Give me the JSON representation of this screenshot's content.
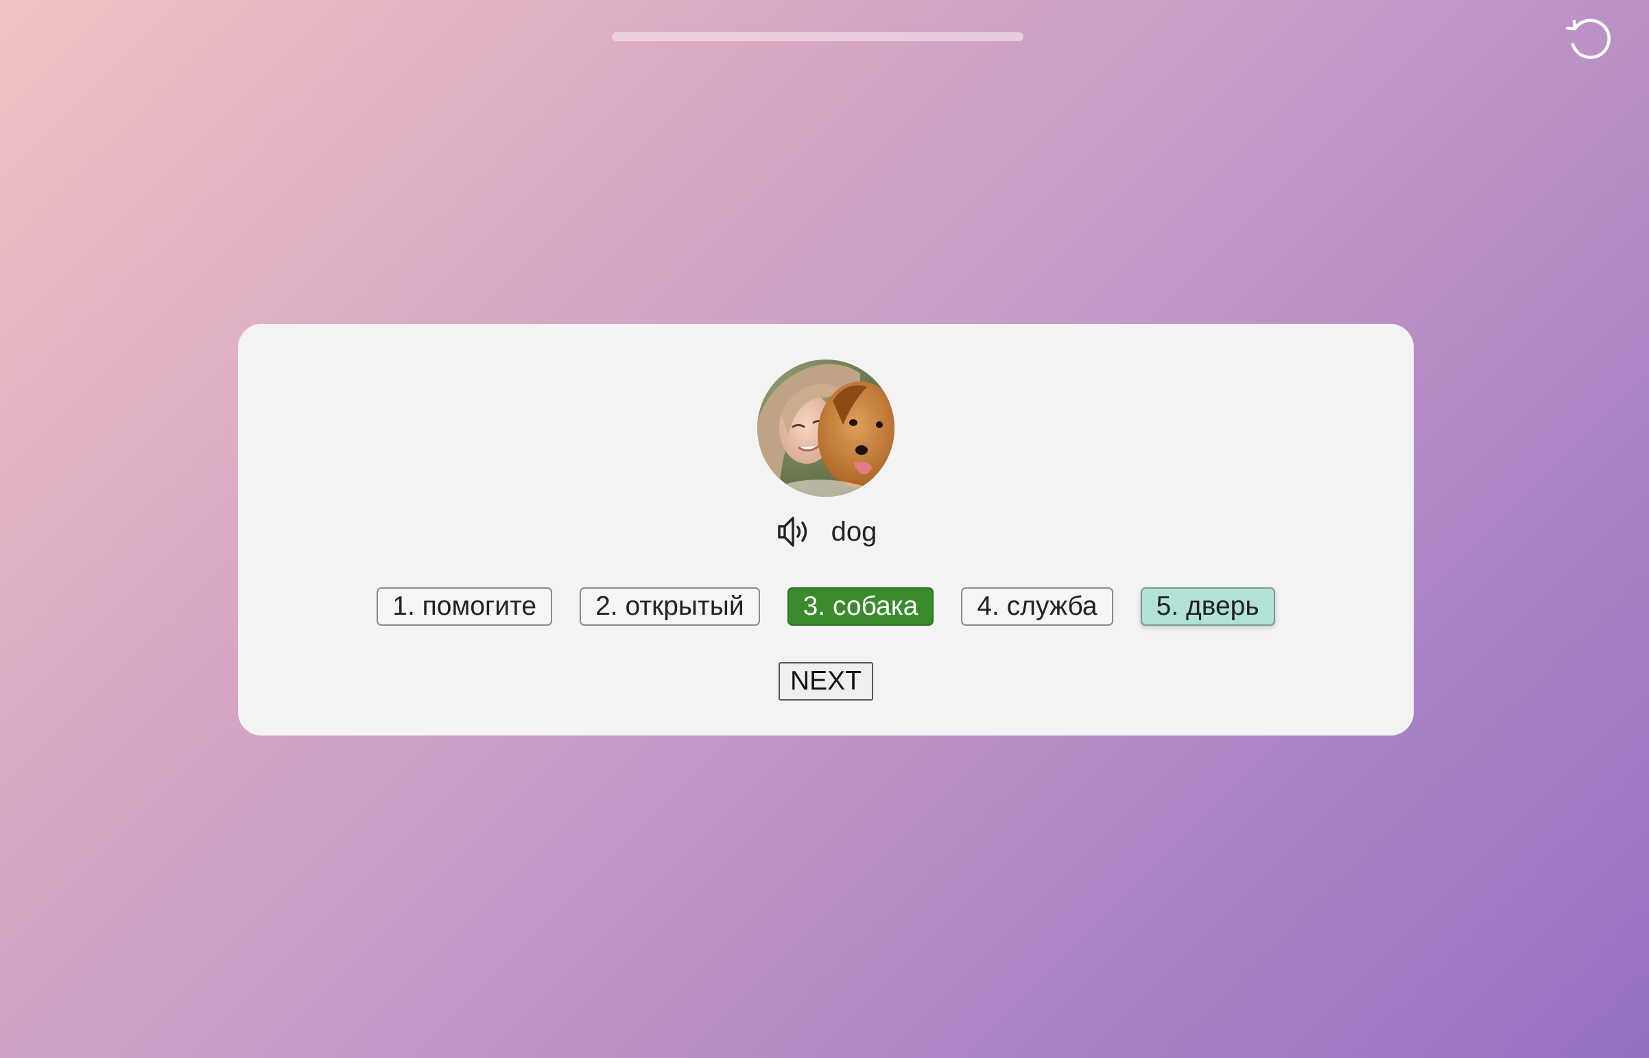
{
  "progress": {
    "value": 0.0
  },
  "toolbar": {
    "reset_icon": "reset-icon"
  },
  "card": {
    "image_icon": "photo-woman-with-dog",
    "speaker_icon": "speaker-icon",
    "word": "dog",
    "options": [
      {
        "label": "1. помогите",
        "state": "default"
      },
      {
        "label": "2. открытый",
        "state": "default"
      },
      {
        "label": "3. собака",
        "state": "correct"
      },
      {
        "label": "4. служба",
        "state": "default"
      },
      {
        "label": "5. дверь",
        "state": "hover"
      }
    ],
    "next_label": "NEXT"
  },
  "colors": {
    "correct": "#3b8b2e",
    "hover": "#b2e2d6",
    "card_bg": "#f3f3f3"
  }
}
